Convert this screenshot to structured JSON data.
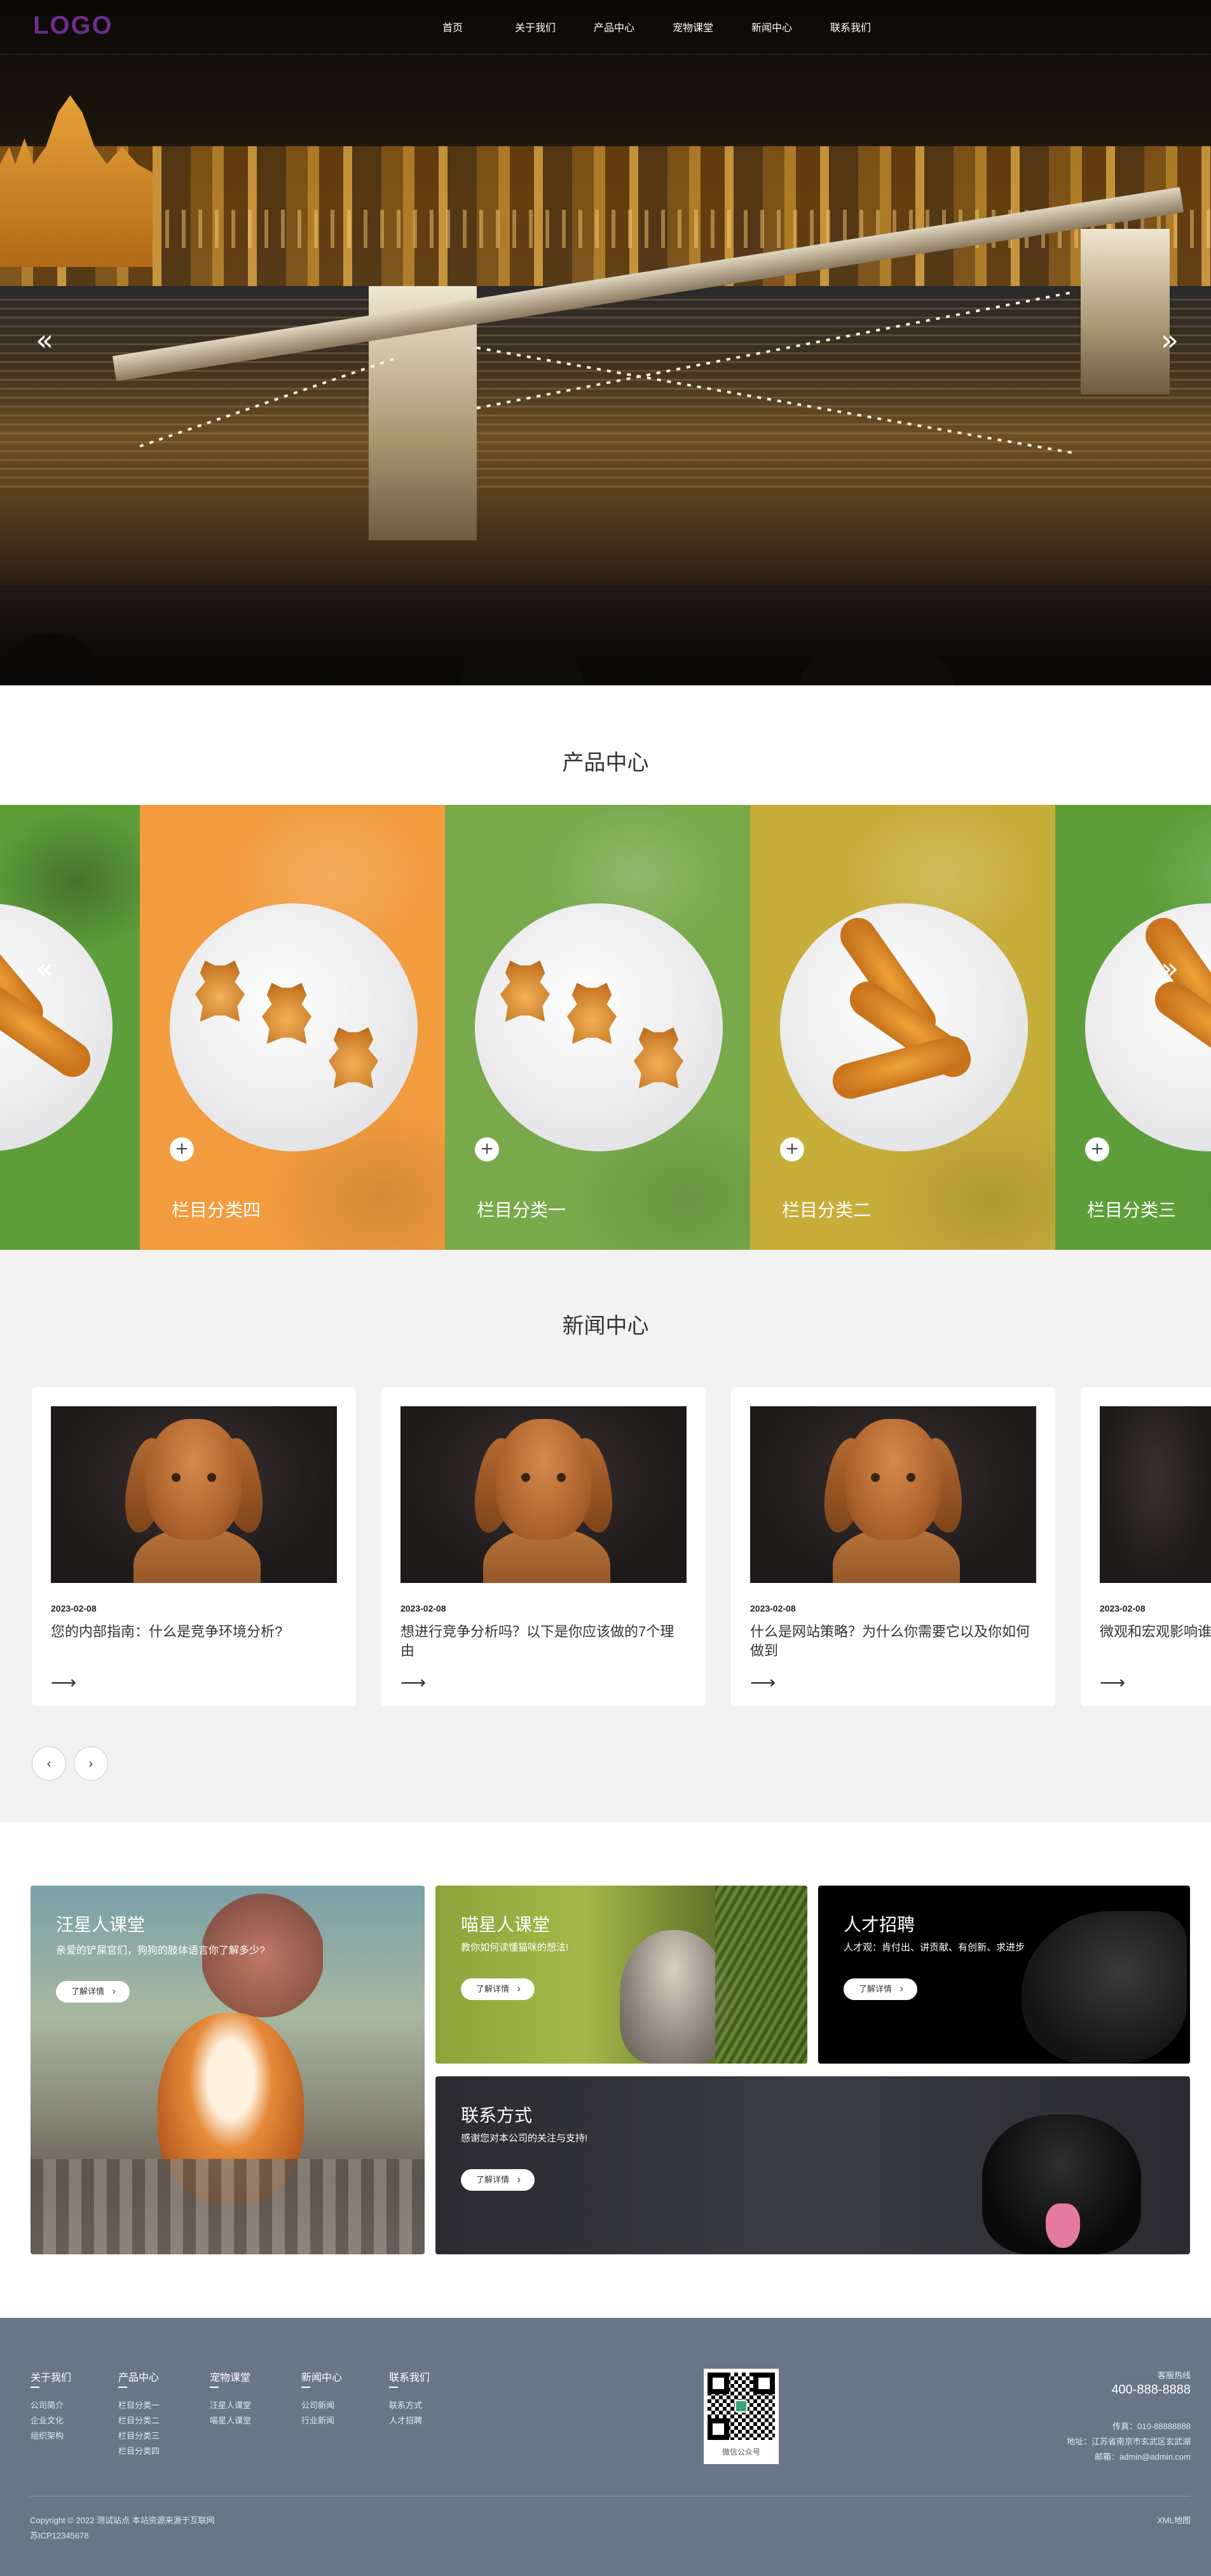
{
  "header": {
    "logo": "LOGO",
    "nav": [
      "首页",
      "关于我们",
      "产品中心",
      "宠物课堂",
      "新闻中心",
      "联系我们"
    ],
    "prev_icon": "«",
    "next_icon": "»"
  },
  "products": {
    "title": "产品中心",
    "items": [
      {
        "label": "栏目分类四",
        "bg": "#f29c3f",
        "cookie": "bear"
      },
      {
        "label": "栏目分类一",
        "bg": "#79a94b",
        "cookie": "bear"
      },
      {
        "label": "栏目分类二",
        "bg": "#c7ad3a",
        "cookie": "bone"
      },
      {
        "label": "栏目分类三",
        "bg": "#5e9e3a",
        "cookie": "bone"
      }
    ],
    "plus_icon": "+",
    "prev_icon": "«",
    "next_icon": "»"
  },
  "news": {
    "title": "新闻中心",
    "items": [
      {
        "date": "2023-02-08",
        "title": "您的内部指南：什么是竞争环境分析?"
      },
      {
        "date": "2023-02-08",
        "title": "想进行竞争分析吗？以下是你应该做的7个理由"
      },
      {
        "date": "2023-02-08",
        "title": "什么是网站策略？为什么你需要它以及你如何做到"
      },
      {
        "date": "2023-02-08",
        "title": "微观和宏观影响谁"
      }
    ],
    "arrow_icon": "⟶",
    "prev_icon": "‹",
    "next_icon": "›"
  },
  "features": {
    "btn_label": "了解详情",
    "blocks": [
      {
        "title": "汪星人课堂",
        "desc": "亲爱的铲屎官们，狗狗的肢体语言你了解多少?"
      },
      {
        "title": "喵星人课堂",
        "desc": "教你如何读懂猫咪的想法!"
      },
      {
        "title": "人才招聘",
        "desc": "人才观：肯付出、讲贡献、有创新、求进步"
      },
      {
        "title": "联系方式",
        "desc": "感谢您对本公司的关注与支持!"
      }
    ]
  },
  "footer": {
    "cols": [
      {
        "head": "关于我们",
        "links": [
          "公司简介",
          "企业文化",
          "组织架构"
        ]
      },
      {
        "head": "产品中心",
        "links": [
          "栏目分类一",
          "栏目分类二",
          "栏目分类三",
          "栏目分类四"
        ]
      },
      {
        "head": "宠物课堂",
        "links": [
          "汪星人课堂",
          "喵星人课堂"
        ]
      },
      {
        "head": "新闻中心",
        "links": [
          "公司新闻",
          "行业新闻"
        ]
      },
      {
        "head": "联系我们",
        "links": [
          "联系方式",
          "人才招聘"
        ]
      }
    ],
    "qr_caption": "微信公众号",
    "hotline_label": "客服热线",
    "hotline": "400-888-8888",
    "fax": "传真：010-88888888",
    "address": "地址：江苏省南京市玄武区玄武湖",
    "email": "邮箱：admin@admin.com",
    "copyright": "Copyright © 2022 测试站点 本站资源来源于互联网",
    "icp": "苏ICP12345678",
    "sitemap": "XML地图"
  }
}
